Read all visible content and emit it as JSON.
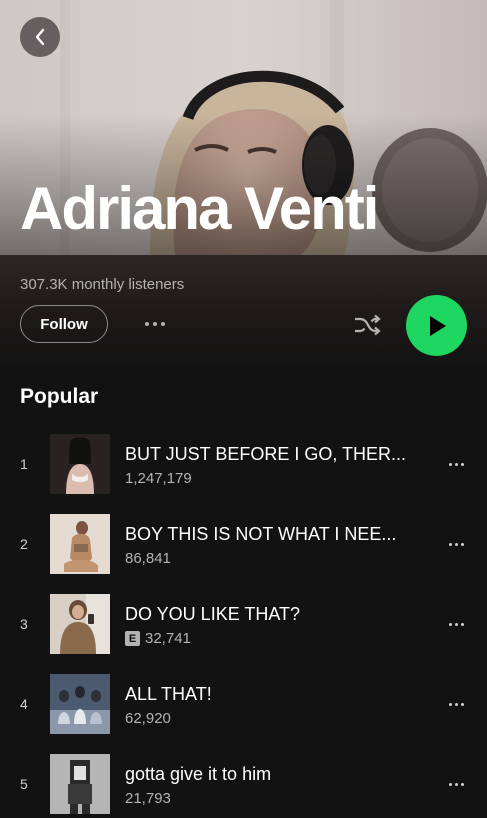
{
  "artist": {
    "name": "Adriana Venti",
    "monthly_listeners": "307.3K monthly listeners"
  },
  "controls": {
    "follow_label": "Follow",
    "back_icon": "chevron-left-icon",
    "more_icon": "more-horizontal-icon",
    "shuffle_icon": "shuffle-icon",
    "play_icon": "play-icon"
  },
  "colors": {
    "background": "#121212",
    "accent_green": "#1ed760",
    "secondary_text": "#b3b3b3"
  },
  "popular": {
    "title": "Popular",
    "tracks": [
      {
        "number": "1",
        "title": "BUT JUST BEFORE I GO, THER...",
        "plays": "1,247,179",
        "explicit": false
      },
      {
        "number": "2",
        "title": "BOY THIS IS NOT WHAT I NEE...",
        "plays": "86,841",
        "explicit": false
      },
      {
        "number": "3",
        "title": "DO YOU LIKE THAT?",
        "plays": "32,741",
        "explicit": true,
        "explicit_label": "E"
      },
      {
        "number": "4",
        "title": "ALL THAT!",
        "plays": "62,920",
        "explicit": false
      },
      {
        "number": "5",
        "title": "gotta give it to him",
        "plays": "21,793",
        "explicit": false
      }
    ]
  }
}
